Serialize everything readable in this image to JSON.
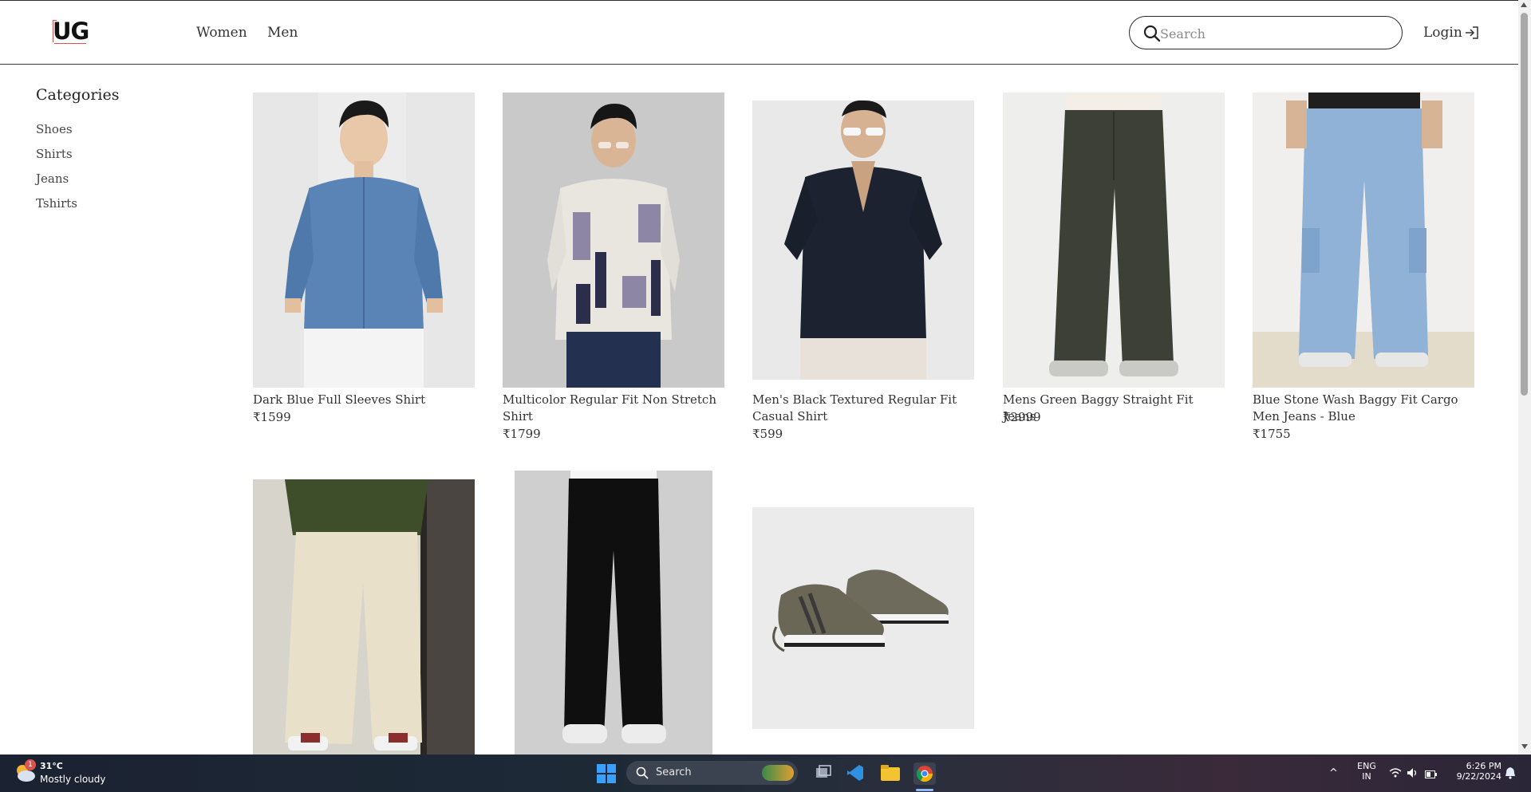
{
  "header": {
    "logo_text": "UG",
    "nav": [
      "Women",
      "Men"
    ],
    "search_placeholder": "Search",
    "login_label": "Login"
  },
  "sidebar": {
    "title": "Categories",
    "items": [
      "Shoes",
      "Shirts",
      "Jeans",
      "Tshirts"
    ]
  },
  "products": [
    {
      "name": "Dark Blue Full Sleeves Shirt",
      "price": "₹1599"
    },
    {
      "name": "Multicolor Regular Fit Non Stretch Shirt",
      "price": "₹1799"
    },
    {
      "name": "Men's Black Textured Regular Fit Casual Shirt",
      "price": "₹599"
    },
    {
      "name": "Mens Green Baggy Straight Fit Jeans",
      "price": "₹2999"
    },
    {
      "name": "Blue Stone Wash Baggy Fit Cargo Men Jeans - Blue",
      "price": "₹1755"
    },
    {
      "name": "",
      "price": ""
    },
    {
      "name": "",
      "price": ""
    },
    {
      "name": "",
      "price": ""
    }
  ],
  "taskbar": {
    "weather_temp": "31°C",
    "weather_desc": "Mostly cloudy",
    "weather_badge": "1",
    "search_label": "Search",
    "lang_line1": "ENG",
    "lang_line2": "IN",
    "time": "6:26 PM",
    "date": "9/22/2024"
  },
  "colors": {
    "accent_logo": "#d9534f",
    "border": "#2b2b2b",
    "text": "#333333"
  }
}
